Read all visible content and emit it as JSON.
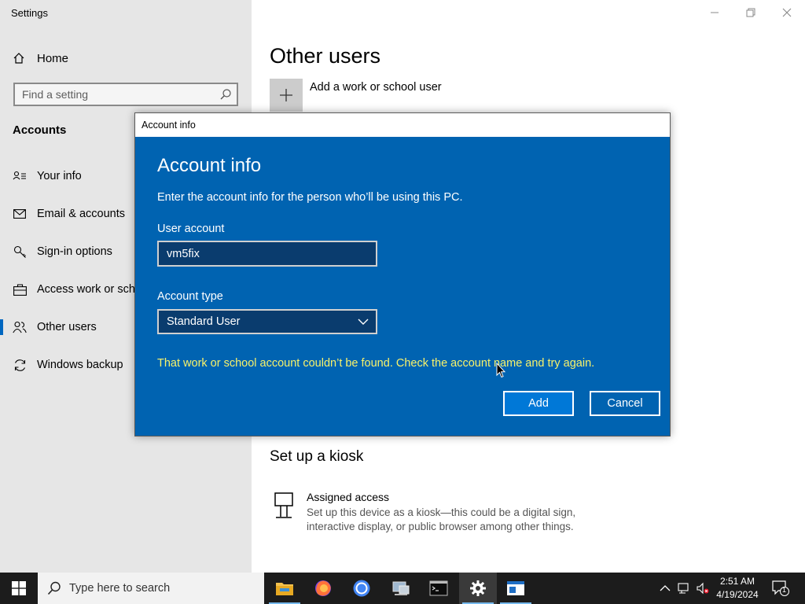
{
  "window": {
    "title": "Settings"
  },
  "sidebar": {
    "home_label": "Home",
    "search_placeholder": "Find a setting",
    "section_title": "Accounts",
    "items": [
      {
        "label": "Your info",
        "icon": "person-card-icon"
      },
      {
        "label": "Email & accounts",
        "icon": "mail-icon"
      },
      {
        "label": "Sign-in options",
        "icon": "key-icon"
      },
      {
        "label": "Access work or scho",
        "icon": "briefcase-icon"
      },
      {
        "label": "Other users",
        "icon": "people-icon",
        "active": true
      },
      {
        "label": "Windows backup",
        "icon": "sync-icon"
      }
    ]
  },
  "main": {
    "title": "Other users",
    "add_work_label": "Add a work or school user",
    "kiosk_title": "Set up a kiosk",
    "kiosk_item_name": "Assigned access",
    "kiosk_item_desc": "Set up this device as a kiosk—this could be a digital sign, interactive display, or public browser among other things."
  },
  "dialog": {
    "titlebar": "Account info",
    "heading": "Account info",
    "description": "Enter the account info for the person who’ll be using this PC.",
    "user_account_label": "User account",
    "user_account_value": "vm5fix",
    "account_type_label": "Account type",
    "account_type_value": "Standard User",
    "error": "That work or school account couldn’t be found. Check the account name and try again.",
    "add_label": "Add",
    "cancel_label": "Cancel"
  },
  "taskbar": {
    "search_placeholder": "Type here to search",
    "time": "2:51 AM",
    "date": "4/19/2024",
    "notification_count": "1"
  },
  "colors": {
    "dialog_bg": "#0063b1",
    "error_text": "#f9f26a",
    "sidebar_bg": "#e6e6e6",
    "accent": "#0067c0"
  }
}
